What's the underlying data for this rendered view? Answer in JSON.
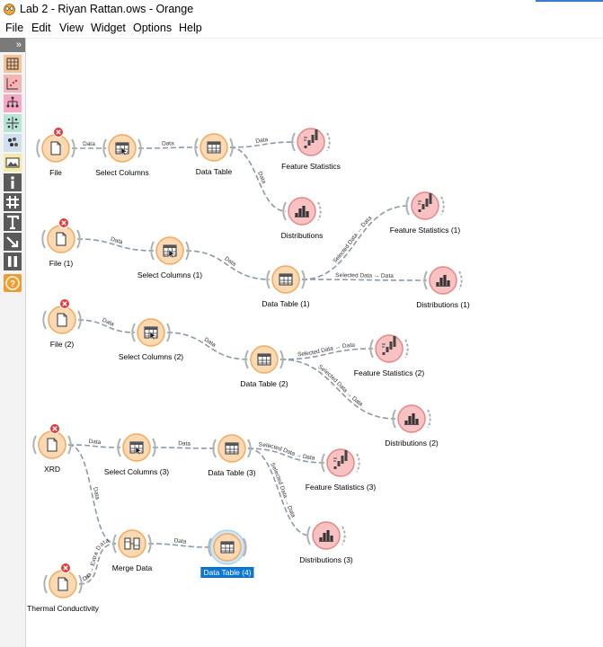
{
  "window": {
    "title": "Lab 2 - Riyan Rattan.ows - Orange"
  },
  "menu": [
    "File",
    "Edit",
    "View",
    "Widget",
    "Options",
    "Help"
  ],
  "dock": {
    "collapse_glyph": "»",
    "categories": [
      {
        "name": "data",
        "color": "#f4c496"
      },
      {
        "name": "visualize",
        "color": "#f2b6b6"
      },
      {
        "name": "model",
        "color": "#f7a8c4"
      },
      {
        "name": "evaluate",
        "color": "#b7e4d6"
      },
      {
        "name": "unsupervised",
        "color": "#cfe0ef"
      },
      {
        "name": "image-analytics",
        "color": "#f4e9a6"
      },
      {
        "name": "info",
        "color": "#5a5a5a"
      },
      {
        "name": "hash",
        "color": "#5a5a5a"
      },
      {
        "name": "text",
        "color": "#5a5a5a"
      },
      {
        "name": "arrow",
        "color": "#5a5a5a"
      },
      {
        "name": "pause",
        "color": "#5a5a5a"
      },
      {
        "name": "help",
        "color": "#f09c2e"
      }
    ]
  },
  "widgets": [
    {
      "id": "file1",
      "label": "File",
      "icon": "file",
      "error": true
    },
    {
      "id": "selcol1",
      "label": "Select Columns",
      "icon": "select-columns"
    },
    {
      "id": "dt1",
      "label": "Data Table",
      "icon": "data-table"
    },
    {
      "id": "fs1",
      "label": "Feature Statistics",
      "icon": "feature-statistics"
    },
    {
      "id": "dist1",
      "label": "Distributions",
      "icon": "distributions"
    },
    {
      "id": "file2",
      "label": "File (1)",
      "icon": "file",
      "error": true
    },
    {
      "id": "selcol2",
      "label": "Select Columns (1)",
      "icon": "select-columns"
    },
    {
      "id": "dt2",
      "label": "Data Table (1)",
      "icon": "data-table"
    },
    {
      "id": "fs2",
      "label": "Feature Statistics (1)",
      "icon": "feature-statistics"
    },
    {
      "id": "dist2",
      "label": "Distributions (1)",
      "icon": "distributions"
    },
    {
      "id": "file3",
      "label": "File (2)",
      "icon": "file",
      "error": true
    },
    {
      "id": "selcol3",
      "label": "Select Columns (2)",
      "icon": "select-columns"
    },
    {
      "id": "dt3",
      "label": "Data Table (2)",
      "icon": "data-table"
    },
    {
      "id": "fs3",
      "label": "Feature Statistics (2)",
      "icon": "feature-statistics"
    },
    {
      "id": "dist3",
      "label": "Distributions (2)",
      "icon": "distributions"
    },
    {
      "id": "xrd",
      "label": "XRD",
      "icon": "file",
      "error": true
    },
    {
      "id": "selcol4",
      "label": "Select Columns (3)",
      "icon": "select-columns"
    },
    {
      "id": "dt4",
      "label": "Data Table (3)",
      "icon": "data-table"
    },
    {
      "id": "fs4",
      "label": "Feature Statistics (3)",
      "icon": "feature-statistics"
    },
    {
      "id": "dist4",
      "label": "Distributions (3)",
      "icon": "distributions"
    },
    {
      "id": "merge",
      "label": "Merge Data",
      "icon": "merge-data"
    },
    {
      "id": "dt5",
      "label": "Data Table (4)",
      "icon": "data-table",
      "selected": true
    },
    {
      "id": "thermal",
      "label": "Thermal Conductivity",
      "icon": "file",
      "error": true
    }
  ],
  "links": [
    {
      "from": "file1",
      "to": "selcol1",
      "label": "Data"
    },
    {
      "from": "selcol1",
      "to": "dt1",
      "label": "Data"
    },
    {
      "from": "dt1",
      "to": "fs1",
      "label": "Data"
    },
    {
      "from": "dt1",
      "to": "dist1",
      "label": "Data"
    },
    {
      "from": "file2",
      "to": "selcol2",
      "label": "Data"
    },
    {
      "from": "selcol2",
      "to": "dt2",
      "label": "Data"
    },
    {
      "from": "dt2",
      "to": "fs2",
      "label": "Selected Data → Data"
    },
    {
      "from": "dt2",
      "to": "dist2",
      "label": "Selected Data → Data"
    },
    {
      "from": "file3",
      "to": "selcol3",
      "label": "Data"
    },
    {
      "from": "selcol3",
      "to": "dt3",
      "label": "Data"
    },
    {
      "from": "dt3",
      "to": "fs3",
      "label": "Selected Data → Data"
    },
    {
      "from": "dt3",
      "to": "dist3",
      "label": "Selected Data → Data"
    },
    {
      "from": "xrd",
      "to": "selcol4",
      "label": "Data"
    },
    {
      "from": "selcol4",
      "to": "dt4",
      "label": "Data"
    },
    {
      "from": "dt4",
      "to": "fs4",
      "label": "Selected Data → Data"
    },
    {
      "from": "dt4",
      "to": "dist4",
      "label": "Selected Data → Data"
    },
    {
      "from": "xrd",
      "to": "merge",
      "label": "Data"
    },
    {
      "from": "thermal",
      "to": "merge",
      "label": "Data → Extra Data"
    },
    {
      "from": "merge",
      "to": "dt5",
      "label": "Data"
    }
  ],
  "colors": {
    "data_widget": "#fbd9b3",
    "data_ring": "#f4a95c",
    "visualize_widget": "#f8c2c2",
    "visualize_ring": "#e98585",
    "error": "#e23b3b",
    "link": "#8a9aaa",
    "selection": "#0b78d7"
  }
}
